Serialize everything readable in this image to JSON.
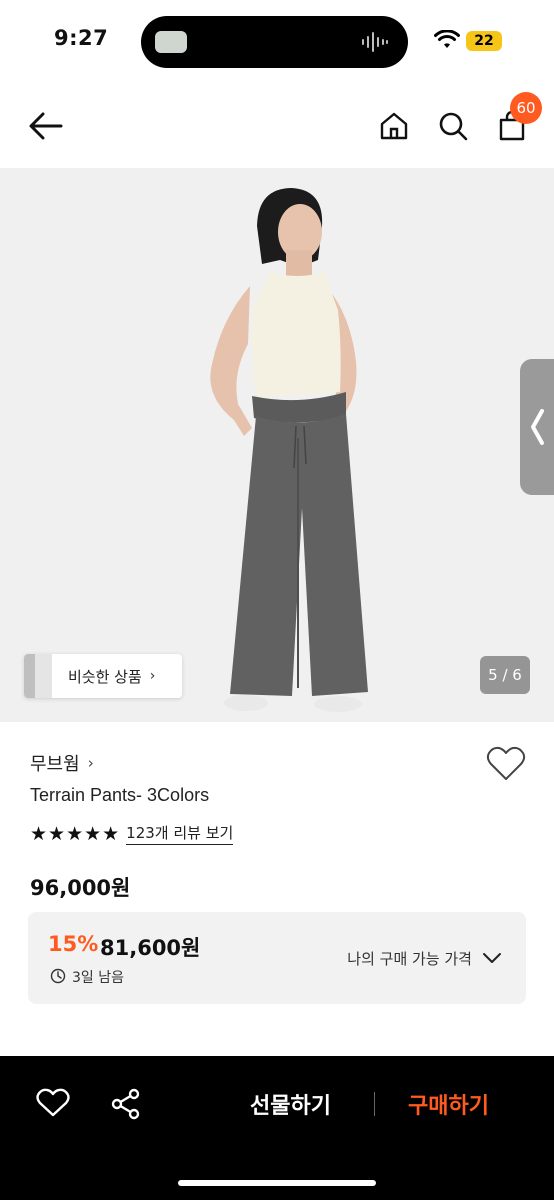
{
  "status_bar": {
    "time": "9:27",
    "battery": "22"
  },
  "nav": {
    "back_icon": "arrow-left-icon",
    "home_icon": "home-icon",
    "search_icon": "search-icon",
    "cart_icon": "bag-icon",
    "cart_count": "60"
  },
  "gallery": {
    "similar_label": "비슷한 상품",
    "similar_chevron": "›",
    "page_indicator": "5 / 6"
  },
  "product": {
    "brand": "무브웜",
    "brand_chevron": "›",
    "title": "Terrain Pants- 3Colors",
    "stars": "★★★★★",
    "review_link": "123개 리뷰 보기",
    "price": "96,000원"
  },
  "discount": {
    "percent": "15%",
    "price": "81,600원",
    "days_left": "3일 남음",
    "my_price_label": "나의 구매 가능 가격"
  },
  "bottom_bar": {
    "gift_label": "선물하기",
    "buy_label": "구매하기"
  },
  "colors": {
    "accent": "#ff5a1f",
    "bottom_bar": "#000000",
    "discount_box": "#f2f2f3"
  }
}
